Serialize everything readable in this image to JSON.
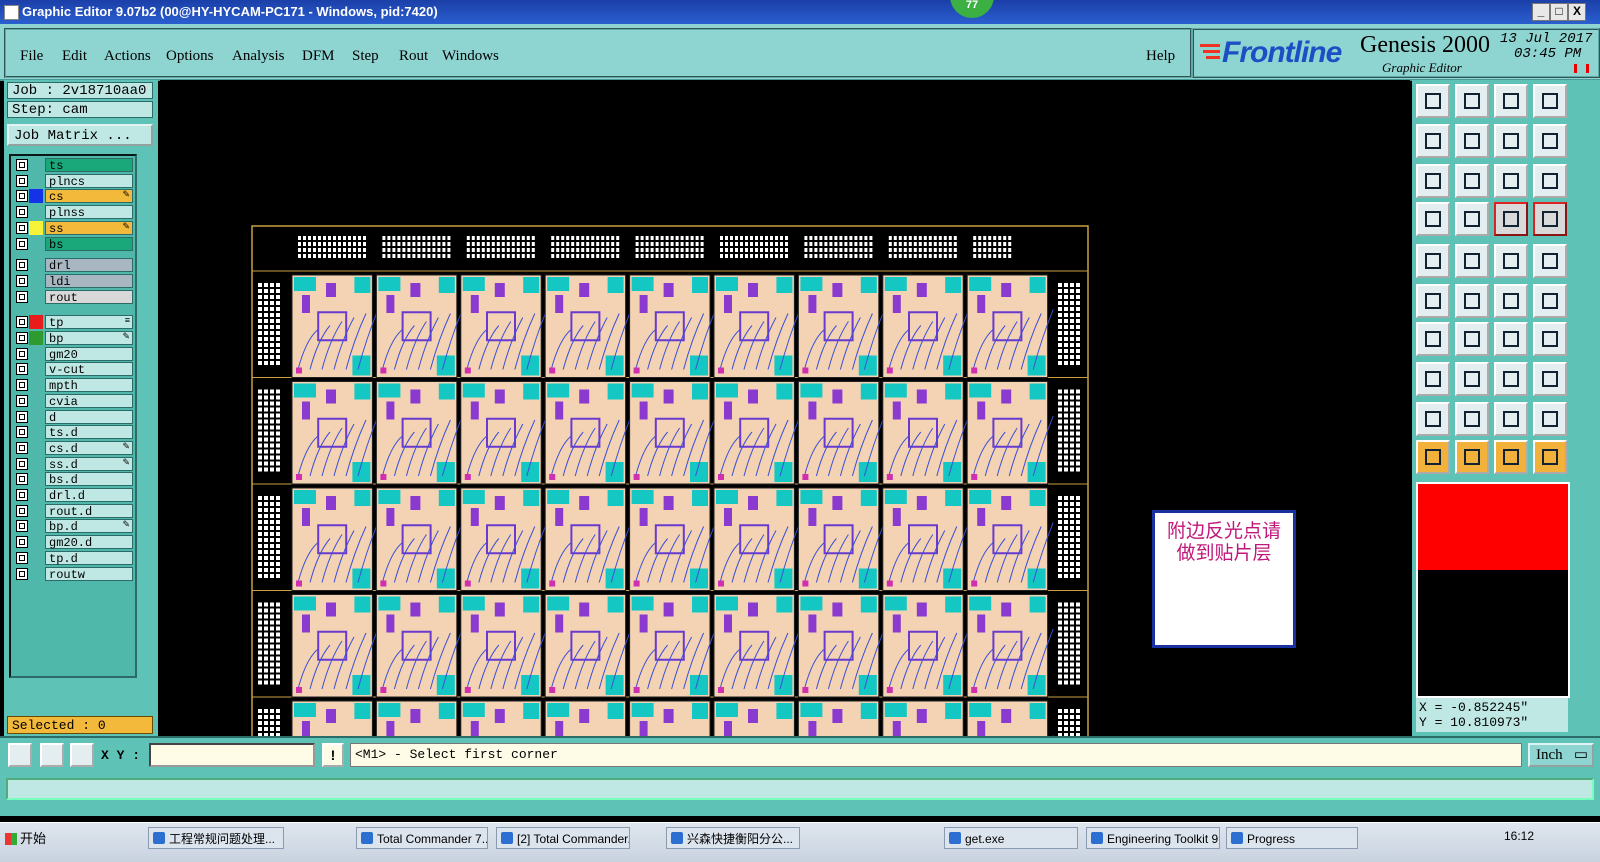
{
  "window": {
    "title": "Graphic Editor 9.07b2 (00@HY-HYCAM-PC171 - Windows, pid:7420)",
    "badge": "77",
    "controls": [
      "_",
      "□",
      "X"
    ]
  },
  "menubar": {
    "items": [
      "File",
      "Edit",
      "Actions",
      "Options",
      "Analysis",
      "DFM",
      "Step",
      "Rout",
      "Windows"
    ],
    "help": "Help"
  },
  "brand": {
    "company": "Frontline",
    "product": "Genesis 2000",
    "subtitle": "Graphic Editor",
    "date": "13 Jul 2017",
    "time": "03:45 PM"
  },
  "job": {
    "job_label": "Job : 2v18710aa0",
    "step_label": "Step: cam",
    "matrix_button": "Job Matrix ..."
  },
  "layers": [
    {
      "name": "ts",
      "bg": "#1aa77a",
      "swatch": "",
      "mark": ""
    },
    {
      "name": "plncs",
      "bg": "#bfe8e4",
      "swatch": "",
      "mark": ""
    },
    {
      "name": "cs",
      "bg": "#f3b93b",
      "swatch": "#1533e6",
      "mark": "✎"
    },
    {
      "name": "plnss",
      "bg": "#bfe8e4",
      "swatch": "",
      "mark": ""
    },
    {
      "name": "ss",
      "bg": "#f3b93b",
      "swatch": "#f6f33a",
      "mark": "✎"
    },
    {
      "name": "bs",
      "bg": "#1aa77a",
      "swatch": "",
      "mark": ""
    },
    {
      "name": "drl",
      "bg": "#a7b6c0",
      "swatch": "",
      "mark": ""
    },
    {
      "name": "ldi",
      "bg": "#a7b6c0",
      "swatch": "",
      "mark": ""
    },
    {
      "name": "rout",
      "bg": "#d8d8d8",
      "swatch": "",
      "mark": ""
    },
    {
      "name": "tp",
      "bg": "#bfe8e4",
      "swatch": "#e81c1c",
      "mark": "≡"
    },
    {
      "name": "bp",
      "bg": "#bfe8e4",
      "swatch": "#2f9a2f",
      "mark": "✎"
    },
    {
      "name": "gm20",
      "bg": "#bfe8e4",
      "swatch": "",
      "mark": ""
    },
    {
      "name": "v-cut",
      "bg": "#bfe8e4",
      "swatch": "",
      "mark": ""
    },
    {
      "name": "mpth",
      "bg": "#bfe8e4",
      "swatch": "",
      "mark": ""
    },
    {
      "name": "cvia",
      "bg": "#bfe8e4",
      "swatch": "",
      "mark": ""
    },
    {
      "name": "d",
      "bg": "#bfe8e4",
      "swatch": "",
      "mark": ""
    },
    {
      "name": "ts.d",
      "bg": "#bfe8e4",
      "swatch": "",
      "mark": ""
    },
    {
      "name": "cs.d",
      "bg": "#bfe8e4",
      "swatch": "",
      "mark": "✎"
    },
    {
      "name": "ss.d",
      "bg": "#bfe8e4",
      "swatch": "",
      "mark": "✎"
    },
    {
      "name": "bs.d",
      "bg": "#bfe8e4",
      "swatch": "",
      "mark": ""
    },
    {
      "name": "drl.d",
      "bg": "#bfe8e4",
      "swatch": "",
      "mark": ""
    },
    {
      "name": "rout.d",
      "bg": "#bfe8e4",
      "swatch": "",
      "mark": ""
    },
    {
      "name": "bp.d",
      "bg": "#bfe8e4",
      "swatch": "",
      "mark": "✎"
    },
    {
      "name": "gm20.d",
      "bg": "#bfe8e4",
      "swatch": "",
      "mark": ""
    },
    {
      "name": "tp.d",
      "bg": "#bfe8e4",
      "swatch": "",
      "mark": ""
    },
    {
      "name": "routw",
      "bg": "#bfe8e4",
      "swatch": "",
      "mark": ""
    }
  ],
  "selected": "Selected : 0",
  "canvas": {
    "annotation_line1": "附边反光点请",
    "annotation_line2": "做到贴片层",
    "panel_rows": 5,
    "panel_cols": 9
  },
  "tools": {
    "icons": [
      "open-icon",
      "save-icon",
      "home-icon",
      "zoom-window-icon",
      "prev-icon",
      "next-icon",
      "fit-icon",
      "redraw-icon",
      "zoom-fit-icon",
      "pan-icon",
      "scale-1-2-icon",
      "help-icon",
      "snap-icon",
      "grid-icon",
      "layer-toggle-icon",
      "layer-toggle-alt-icon",
      "circle-icon",
      "measure-icon",
      "ruler-icon",
      "dot-icon",
      "node-icon",
      "cross-icon",
      "point-icon",
      "point-alt-icon",
      "line-icon",
      "line-alt-icon",
      "arc-icon",
      "symbol-icon",
      "pad-icon",
      "dash-icon",
      "move-icon",
      "copy-icon",
      "triangle-icon",
      "triangle-alt-icon",
      "letter-a-icon",
      "letter-a-alt-icon",
      "pointer-icon",
      "pointer-select-icon",
      "pointer-move-icon",
      "pointer-net-icon"
    ],
    "coord_x": "X = -0.852245\"",
    "coord_y": "Y = 10.810973\""
  },
  "command": {
    "xy_label": "X Y :",
    "xy_value": "",
    "exclaim": "!",
    "prompt": "<M1> - Select first corner",
    "unit": "Inch"
  },
  "taskbar": {
    "start": "开始",
    "tasks": [
      "工程常规问题处理...",
      "Total Commander 7....",
      "[2] Total Commander...",
      "兴森快捷衡阳分公...",
      "get.exe",
      "Engineering Toolkit 9....",
      "Progress"
    ],
    "clock": "16:12"
  }
}
